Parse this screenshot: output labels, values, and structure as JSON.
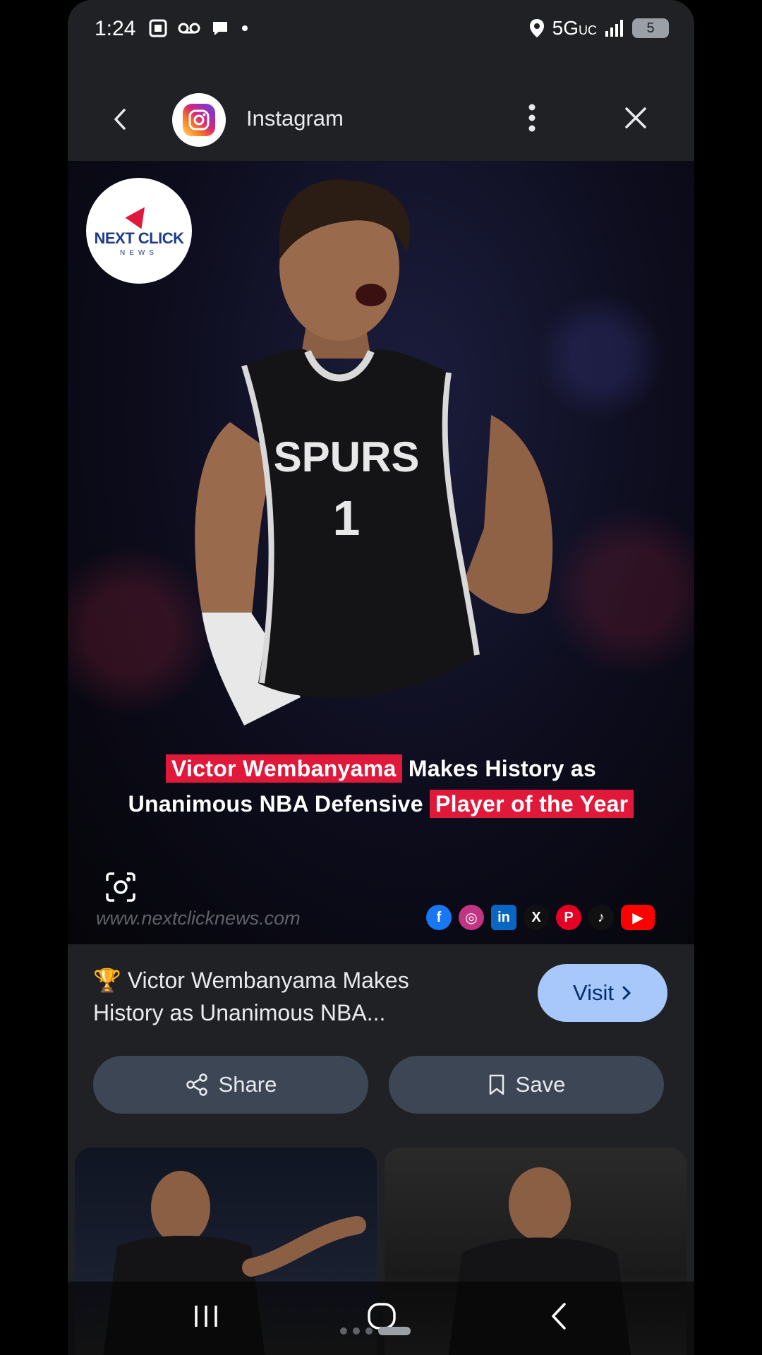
{
  "status_bar": {
    "time": "1:24",
    "network": "5G",
    "network_sub": "UC",
    "battery": "5"
  },
  "header": {
    "title": "Instagram"
  },
  "hero": {
    "brand_name": "NEXT CLICK",
    "brand_sub": "NEWS",
    "caption_part1": "Victor Wembanyama",
    "caption_part2": "Makes History as",
    "caption_part3": "Unanimous NBA Defensive",
    "caption_part4": "Player of the Year",
    "jersey_text": "SPURS",
    "jersey_number": "1",
    "watermark": "www.nextclicknews.com",
    "socials": [
      "f",
      "◎",
      "in",
      "X",
      "P",
      "♪",
      "▶"
    ]
  },
  "result": {
    "title": "🏆 Victor Wembanyama Makes History as Unanimous NBA...",
    "visit_label": "Visit",
    "share_label": "Share",
    "save_label": "Save"
  },
  "colors": {
    "accent": "#a8c7fa",
    "highlight": "#e0183a",
    "surface": "#202124",
    "button": "#3c4655"
  }
}
